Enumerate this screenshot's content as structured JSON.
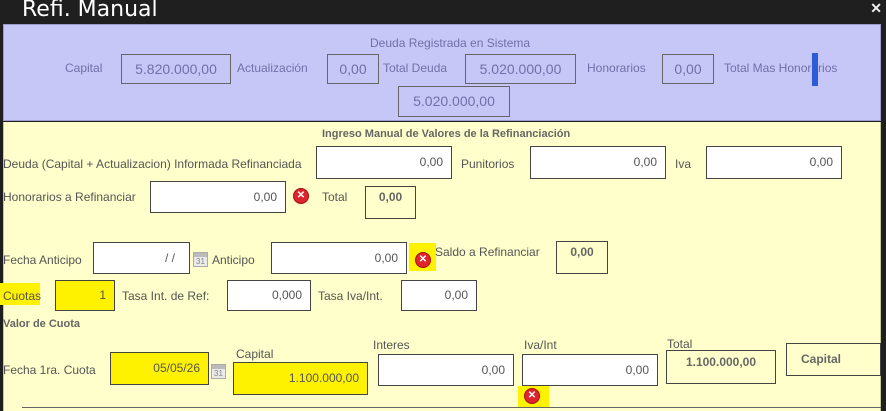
{
  "window": {
    "title": "Refi. Manual",
    "close_glyph": "✕"
  },
  "sistema": {
    "title": "Deuda Registrada en Sistema",
    "capital_label": "Capital",
    "capital_value": "5.820.000,00",
    "actualizacion_label": "Actualización",
    "actualizacion_value": "0,00",
    "total_deuda_label": "Total Deuda",
    "total_deuda_value": "5.020.000,00",
    "honorarios_label": "Honorarios",
    "honorarios_value": "0,00",
    "total_mas_honorarios_label": "Total Mas Honorarios",
    "total_mas_honorarios_value": "5.020.000,00"
  },
  "manual": {
    "title": "Ingreso Manual de Valores de la Refinanciación",
    "deuda_label": "Deuda (Capital + Actualizacion) Informada Refinanciada",
    "deuda_value": "0,00",
    "punitorios_label": "Punitorios",
    "punitorios_value": "0,00",
    "iva_label": "Iva",
    "iva_value": "0,00",
    "honorarios_label": "Honorarios a Refinanciar",
    "honorarios_value": "0,00",
    "total_label": "Total",
    "total_value": "0,00",
    "fecha_anticipo_label": "Fecha Anticipo",
    "fecha_anticipo_value": "/ /",
    "anticipo_label": "Anticipo",
    "anticipo_value": "0,00",
    "saldo_label": "Saldo a Refinanciar",
    "saldo_value": "0,00",
    "cuotas_label": "Cuotas",
    "cuotas_value": "1",
    "tasa_label": "Tasa Int. de Ref:",
    "tasa_value": "0,000",
    "tasa_iva_label": "Tasa Iva/Int.",
    "tasa_iva_value": "0,00",
    "valor_cuota_label": "Valor de Cuota",
    "fecha_1ra_label": "Fecha 1ra. Cuota",
    "fecha_1ra_value": "05/05/26",
    "capital_label": "Capital",
    "capital_value": "1.100.000,00",
    "interes_label": "Interes",
    "interes_value": "0,00",
    "iva_int_label": "Iva/Int",
    "iva_int_value": "0,00",
    "total_cuota_label": "Total",
    "total_cuota_value": "1.100.000,00",
    "tipo_select_value": "Capital"
  },
  "icons": {
    "error": "✕",
    "calendar": "31"
  },
  "colors": {
    "purple_panel": "#c7c7f7",
    "yellow_panel": "#ffffcc",
    "highlight": "#fff200",
    "error": "#e0242b"
  }
}
